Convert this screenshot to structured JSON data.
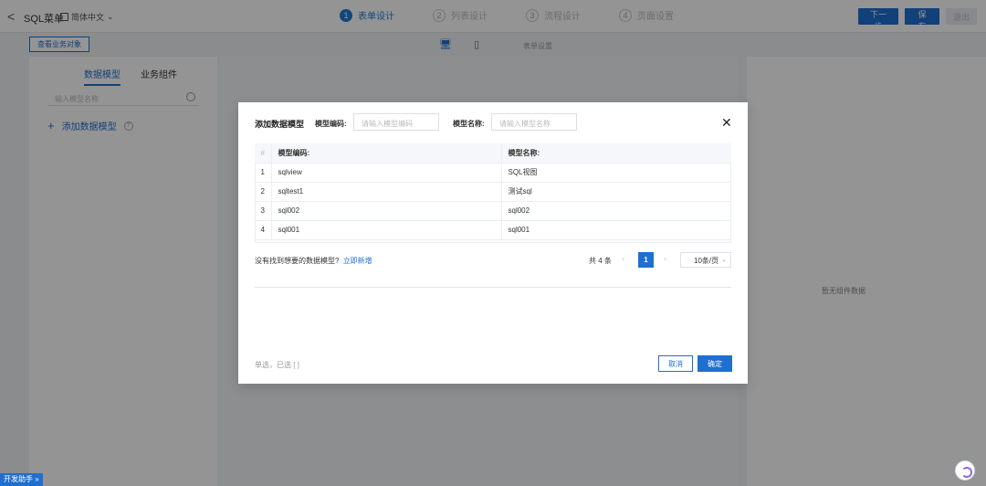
{
  "topbar": {
    "back_glyph": "<",
    "app_title": "SQL菜单",
    "language": "简体中文",
    "steps": [
      {
        "num": "1",
        "label": "表单设计"
      },
      {
        "num": "2",
        "label": "列表设计"
      },
      {
        "num": "3",
        "label": "流程设计"
      },
      {
        "num": "4",
        "label": "页面设置"
      }
    ],
    "next_label": "下一步",
    "save_label": "保存",
    "exit_label": "退出"
  },
  "subbar": {
    "view_objects_label": "查看业务对象",
    "form_setting_label": "表单设置"
  },
  "left_panel": {
    "tabs": [
      "数据模型",
      "业务组件"
    ],
    "search_placeholder": "输入模型名称",
    "add_model_label": "添加数据模型"
  },
  "right_panel": {
    "empty_text": "暂无组件数据"
  },
  "modal": {
    "title": "添加数据模型",
    "code_label": "模型编码:",
    "code_placeholder": "请输入模型编码",
    "name_label": "模型名称:",
    "name_placeholder": "请输入模型名称",
    "close_glyph": "✕",
    "table": {
      "headers": [
        "#",
        "模型编码:",
        "模型名称:"
      ],
      "rows": [
        {
          "idx": "1",
          "code": "sqlview",
          "name": "SQL视图"
        },
        {
          "idx": "2",
          "code": "sqltest1",
          "name": "测试sql"
        },
        {
          "idx": "3",
          "code": "sql002",
          "name": "sql002"
        },
        {
          "idx": "4",
          "code": "sql001",
          "name": "sql001"
        }
      ]
    },
    "not_found_text": "没有找到想要的数据模型?",
    "create_link": "立即新增",
    "pager": {
      "total": "共 4 条",
      "prev_glyph": "‹",
      "current_page": "1",
      "next_glyph": "›",
      "page_size": "10条/页"
    },
    "selection_info": "单选，已选 [ ]",
    "cancel_label": "取消",
    "ok_label": "确定"
  },
  "dev_helper_label": "开发助手 »",
  "colors": {
    "primary": "#1f6fd1",
    "overlay": "rgba(0,0,0,0.42)"
  }
}
